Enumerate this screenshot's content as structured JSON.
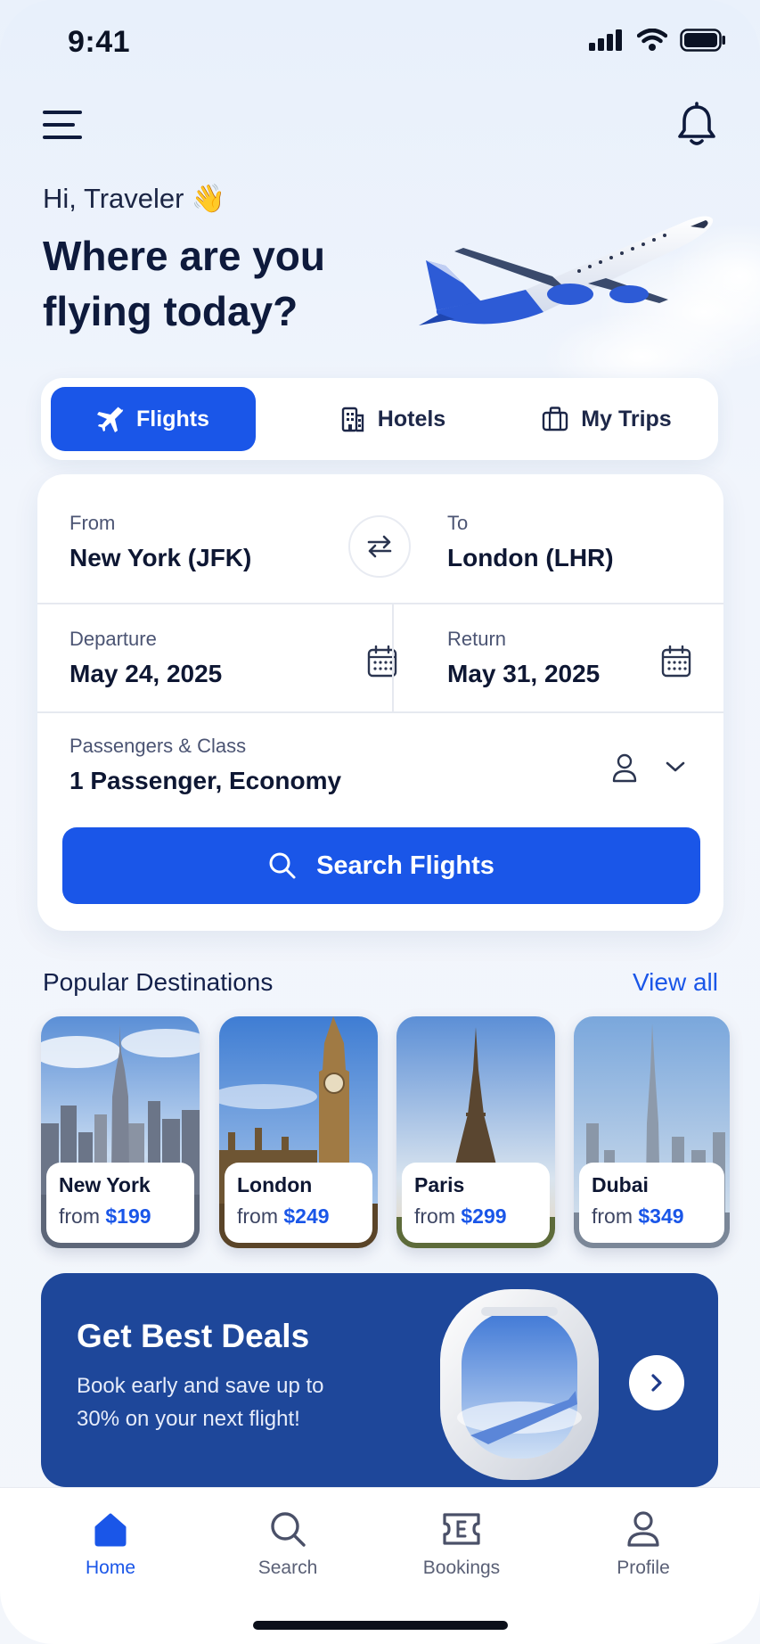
{
  "status_bar": {
    "time": "9:41"
  },
  "header": {
    "greeting": "Hi, Traveler",
    "greeting_emoji": "👋",
    "headline": "Where are you flying today?"
  },
  "tabs": [
    {
      "label": "Flights",
      "icon": "plane-icon",
      "active": true
    },
    {
      "label": "Hotels",
      "icon": "building-icon",
      "active": false
    },
    {
      "label": "My Trips",
      "icon": "suitcase-icon",
      "active": false
    }
  ],
  "search_form": {
    "from": {
      "label": "From",
      "value": "New York (JFK)"
    },
    "to": {
      "label": "To",
      "value": "London (LHR)"
    },
    "departure": {
      "label": "Departure",
      "value": "May 24, 2025"
    },
    "return": {
      "label": "Return",
      "value": "May 31, 2025"
    },
    "passengers": {
      "label": "Passengers & Class",
      "value": "1 Passenger, Economy"
    },
    "search_button": "Search Flights"
  },
  "destinations": {
    "title": "Popular Destinations",
    "view_all": "View all",
    "items": [
      {
        "name": "New York",
        "from": "from",
        "price": "$199"
      },
      {
        "name": "London",
        "from": "from",
        "price": "$249"
      },
      {
        "name": "Paris",
        "from": "from",
        "price": "$299"
      },
      {
        "name": "Dubai",
        "from": "from",
        "price": "$349"
      }
    ]
  },
  "deal": {
    "title": "Get Best Deals",
    "subtitle": "Book early and save up to 30% on your next flight!"
  },
  "bottom_nav": [
    {
      "label": "Home",
      "icon": "home-icon",
      "active": true
    },
    {
      "label": "Search",
      "icon": "search-icon",
      "active": false
    },
    {
      "label": "Bookings",
      "icon": "ticket-icon",
      "active": false
    },
    {
      "label": "Profile",
      "icon": "profile-icon",
      "active": false
    }
  ],
  "colors": {
    "accent": "#1a56e8",
    "deal_bg": "#1e479a",
    "text_dark": "#0e1a3c"
  }
}
